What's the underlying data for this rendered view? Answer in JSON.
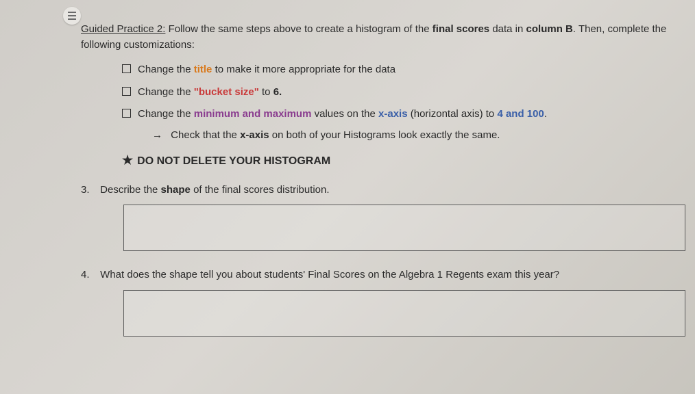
{
  "header": {
    "title_underlined": "Guided Practice 2:",
    "title_rest_1": " Follow the same steps above to create a histogram of the ",
    "title_bold_1": "final scores",
    "title_rest_2": " data in ",
    "title_bold_2": "column B",
    "title_rest_3": ". Then, complete the following customizations:"
  },
  "checklist": {
    "item1": {
      "pre": "Change the ",
      "highlight": "title",
      "post": " to make it more appropriate for the data"
    },
    "item2": {
      "pre": "Change the ",
      "highlight": "\"bucket size\"",
      "post": " to ",
      "bold_end": "6."
    },
    "item3": {
      "pre": "Change the ",
      "highlight1": "minimum and maximum",
      "mid1": " values on the ",
      "highlight2": "x-axis",
      "mid2": " (horizontal axis) to ",
      "highlight3": "4 and 100",
      "end": "."
    },
    "sub": {
      "pre": "Check that the ",
      "bold": "x-axis",
      "post": " on both of your Histograms look exactly the same."
    }
  },
  "warning": "DO NOT DELETE YOUR HISTOGRAM",
  "q3": {
    "num": "3.",
    "pre": "Describe the ",
    "bold": "shape",
    "post": " of the final scores distribution."
  },
  "q4": {
    "num": "4.",
    "text": "What does the shape tell you about students' Final Scores on the Algebra 1 Regents exam this year?"
  }
}
